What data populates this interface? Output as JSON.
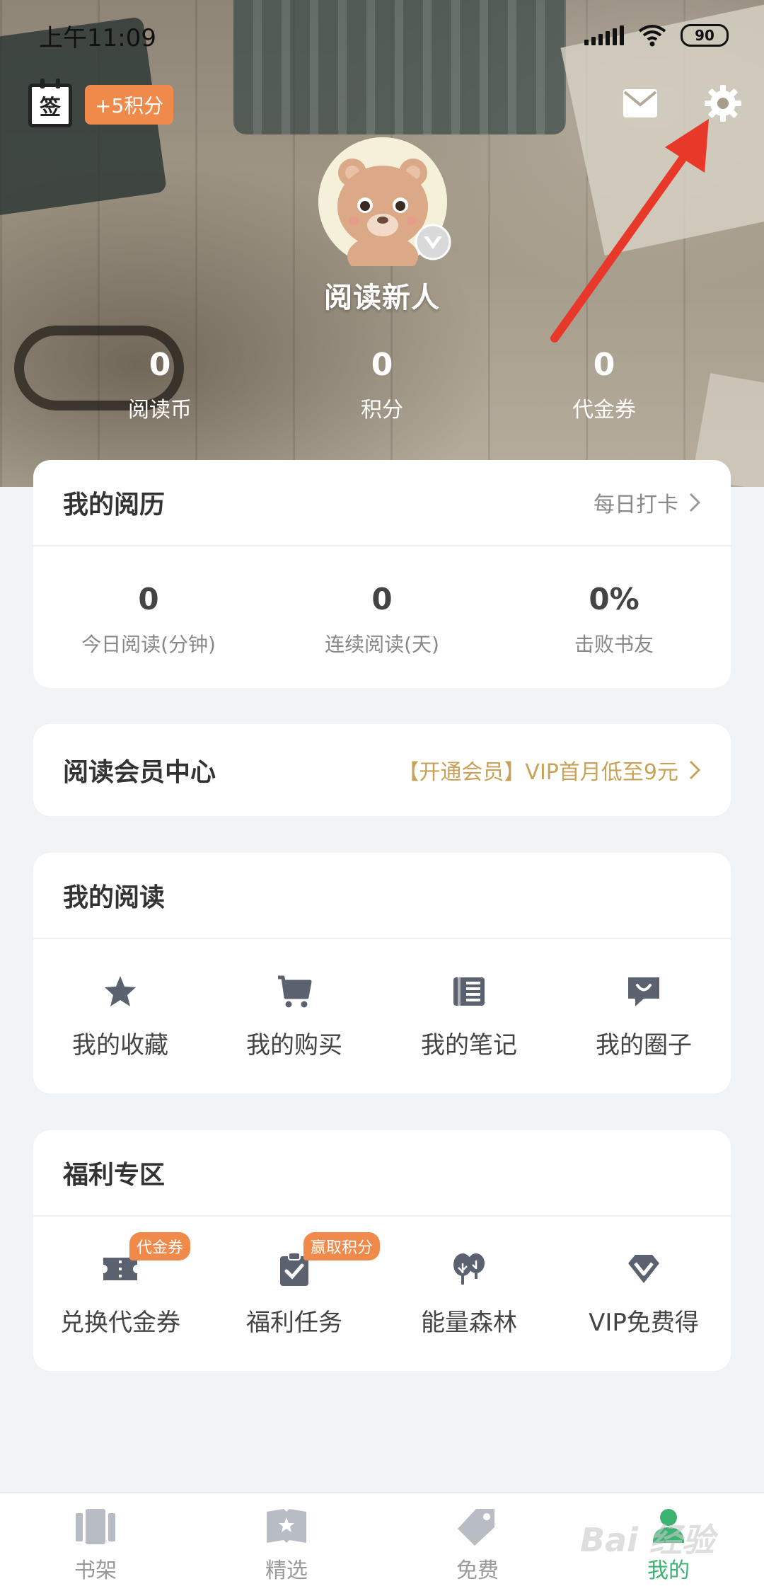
{
  "status_bar": {
    "time": "上午11:09",
    "battery": "90"
  },
  "header": {
    "sign_icon_text": "签",
    "points_badge": "+5积分",
    "username": "阅读新人",
    "stats": [
      {
        "value": "0",
        "label": "阅读币"
      },
      {
        "value": "0",
        "label": "积分"
      },
      {
        "value": "0",
        "label": "代金券"
      }
    ]
  },
  "history": {
    "title": "我的阅历",
    "link": "每日打卡",
    "items": [
      {
        "value": "0",
        "label": "今日阅读(分钟)"
      },
      {
        "value": "0",
        "label": "连续阅读(天)"
      },
      {
        "value": "0%",
        "label": "击败书友"
      }
    ]
  },
  "vip": {
    "title": "阅读会员中心",
    "link": "【开通会员】VIP首月低至9元"
  },
  "my_reading": {
    "title": "我的阅读",
    "items": [
      {
        "label": "我的收藏",
        "icon": "star-icon"
      },
      {
        "label": "我的购买",
        "icon": "cart-icon"
      },
      {
        "label": "我的笔记",
        "icon": "notebook-icon"
      },
      {
        "label": "我的圈子",
        "icon": "chat-bubble-icon"
      }
    ]
  },
  "welfare": {
    "title": "福利专区",
    "items": [
      {
        "label": "兑换代金券",
        "icon": "ticket-icon",
        "tag": "代金券"
      },
      {
        "label": "福利任务",
        "icon": "clipboard-check-icon",
        "tag": "赢取积分"
      },
      {
        "label": "能量森林",
        "icon": "tree-icon"
      },
      {
        "label": "VIP免费得",
        "icon": "diamond-icon"
      }
    ]
  },
  "bottom_nav": [
    {
      "label": "书架",
      "icon": "bookshelf-icon"
    },
    {
      "label": "精选",
      "icon": "featured-book-icon"
    },
    {
      "label": "免费",
      "icon": "price-tag-icon"
    },
    {
      "label": "我的",
      "icon": "profile-icon",
      "active": true
    }
  ],
  "colors": {
    "accent_green": "#3cb371",
    "badge_orange": "#f08a4b",
    "vip_gold": "#c9a25a",
    "annotation_red": "#e8382a"
  },
  "watermark": "Bai 经验"
}
